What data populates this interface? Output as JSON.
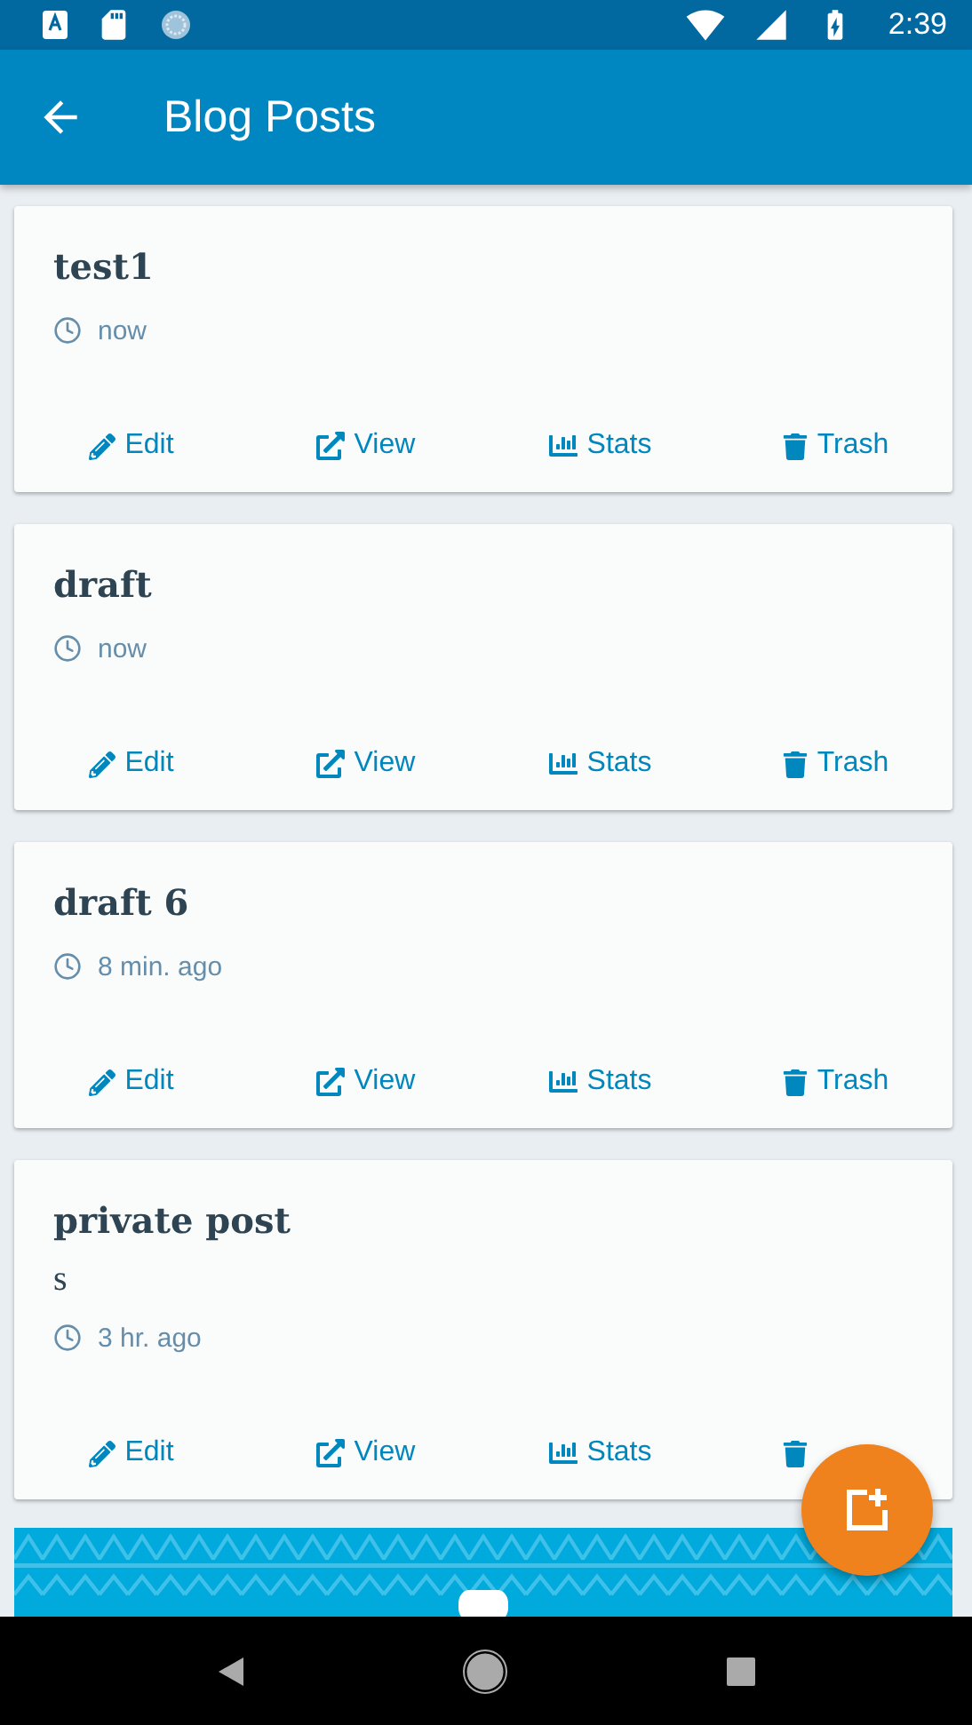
{
  "status_bar": {
    "time": "2:39"
  },
  "app_bar": {
    "title": "Blog Posts"
  },
  "posts": [
    {
      "title": "test1",
      "time": "now",
      "actions": [
        {
          "kind": "edit",
          "label": "Edit"
        },
        {
          "kind": "view",
          "label": "View"
        },
        {
          "kind": "stats",
          "label": "Stats"
        },
        {
          "kind": "trash",
          "label": "Trash"
        }
      ]
    },
    {
      "title": "draft",
      "time": "now",
      "actions": [
        {
          "kind": "edit",
          "label": "Edit"
        },
        {
          "kind": "view",
          "label": "View"
        },
        {
          "kind": "stats",
          "label": "Stats"
        },
        {
          "kind": "trash",
          "label": "Trash"
        }
      ]
    },
    {
      "title": "draft 6",
      "time": "8 min. ago",
      "actions": [
        {
          "kind": "edit",
          "label": "Edit"
        },
        {
          "kind": "view",
          "label": "View"
        },
        {
          "kind": "stats",
          "label": "Stats"
        },
        {
          "kind": "trash",
          "label": "Trash"
        }
      ]
    },
    {
      "title": "private post",
      "excerpt": "s",
      "time": "3 hr. ago",
      "actions": [
        {
          "kind": "edit",
          "label": "Edit"
        },
        {
          "kind": "view",
          "label": "View"
        },
        {
          "kind": "stats",
          "label": "Stats"
        },
        {
          "kind": "trash"
        }
      ]
    }
  ]
}
